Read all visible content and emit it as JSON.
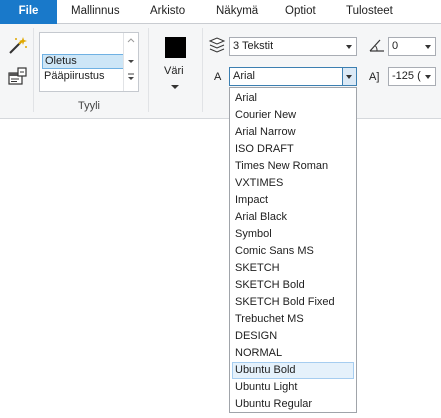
{
  "tabs": [
    "File",
    "Mallinnus",
    "Arkisto",
    "Näkymä",
    "Optiot",
    "Tulosteet"
  ],
  "style_group": {
    "items": [
      "Oletus",
      "Pääpiirustus"
    ],
    "selected": "Oletus",
    "label": "Tyyli"
  },
  "color": {
    "label": "Väri",
    "value": "#000000"
  },
  "text_style_combo": {
    "value": "3 Tekstit"
  },
  "font_combo": {
    "value": "Arial",
    "prefix": "A"
  },
  "angle_combo": {
    "value": "0"
  },
  "size_combo": {
    "value": "-125 (",
    "prefix": "A]"
  },
  "font_dropdown": {
    "items": [
      "Arial",
      "Courier New",
      "Arial Narrow",
      "ISO DRAFT",
      "Times New Roman",
      "VXTIMES",
      "Impact",
      "Arial Black",
      "Symbol",
      "Comic Sans MS",
      "SKETCH",
      "SKETCH Bold",
      "SKETCH Bold Fixed",
      "Trebuchet MS",
      "DESIGN",
      "NORMAL",
      "Ubuntu Bold",
      "Ubuntu Light",
      "Ubuntu Regular"
    ],
    "highlighted": "Ubuntu Bold"
  },
  "icons": [
    "magic-wand-icon",
    "properties-icon",
    "layers-icon",
    "text-angle-icon"
  ]
}
